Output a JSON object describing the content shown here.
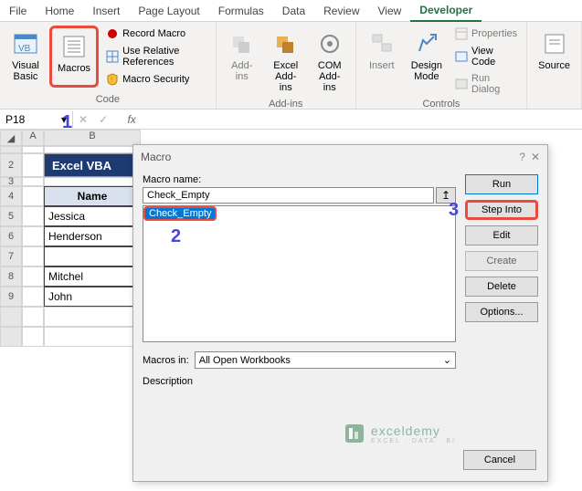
{
  "ribbon": {
    "tabs": [
      "File",
      "Home",
      "Insert",
      "Page Layout",
      "Formulas",
      "Data",
      "Review",
      "View",
      "Developer"
    ],
    "active_tab": "Developer",
    "groups": {
      "code": {
        "title": "Code",
        "visual_basic": "Visual\nBasic",
        "macros": "Macros",
        "record_macro": "Record Macro",
        "use_relative": "Use Relative References",
        "macro_security": "Macro Security"
      },
      "addins": {
        "title": "Add-ins",
        "addins": "Add-\nins",
        "excel_addins": "Excel\nAdd-ins",
        "com_addins": "COM\nAdd-ins"
      },
      "controls": {
        "title": "Controls",
        "insert": "Insert",
        "design_mode": "Design\nMode",
        "properties": "Properties",
        "view_code": "View Code",
        "run_dialog": "Run Dialog"
      },
      "source": "Source"
    }
  },
  "name_box": "P18",
  "sheet": {
    "title_row": "Excel VBA",
    "header": "Name",
    "rows": [
      "Jessica",
      "Henderson",
      "",
      "Mitchel",
      "John"
    ]
  },
  "dialog": {
    "title": "Macro",
    "label_macro_name": "Macro name:",
    "macro_name_value": "Check_Empty",
    "list": [
      "Check_Empty"
    ],
    "label_macros_in": "Macros in:",
    "macros_in_value": "All Open Workbooks",
    "label_description": "Description",
    "buttons": {
      "run": "Run",
      "step_into": "Step Into",
      "edit": "Edit",
      "create": "Create",
      "delete": "Delete",
      "options": "Options...",
      "cancel": "Cancel"
    }
  },
  "watermark": {
    "main": "exceldemy",
    "sub": "EXCEL · DATA · BI"
  },
  "annotations": {
    "one": "1",
    "two": "2",
    "three": "3"
  }
}
